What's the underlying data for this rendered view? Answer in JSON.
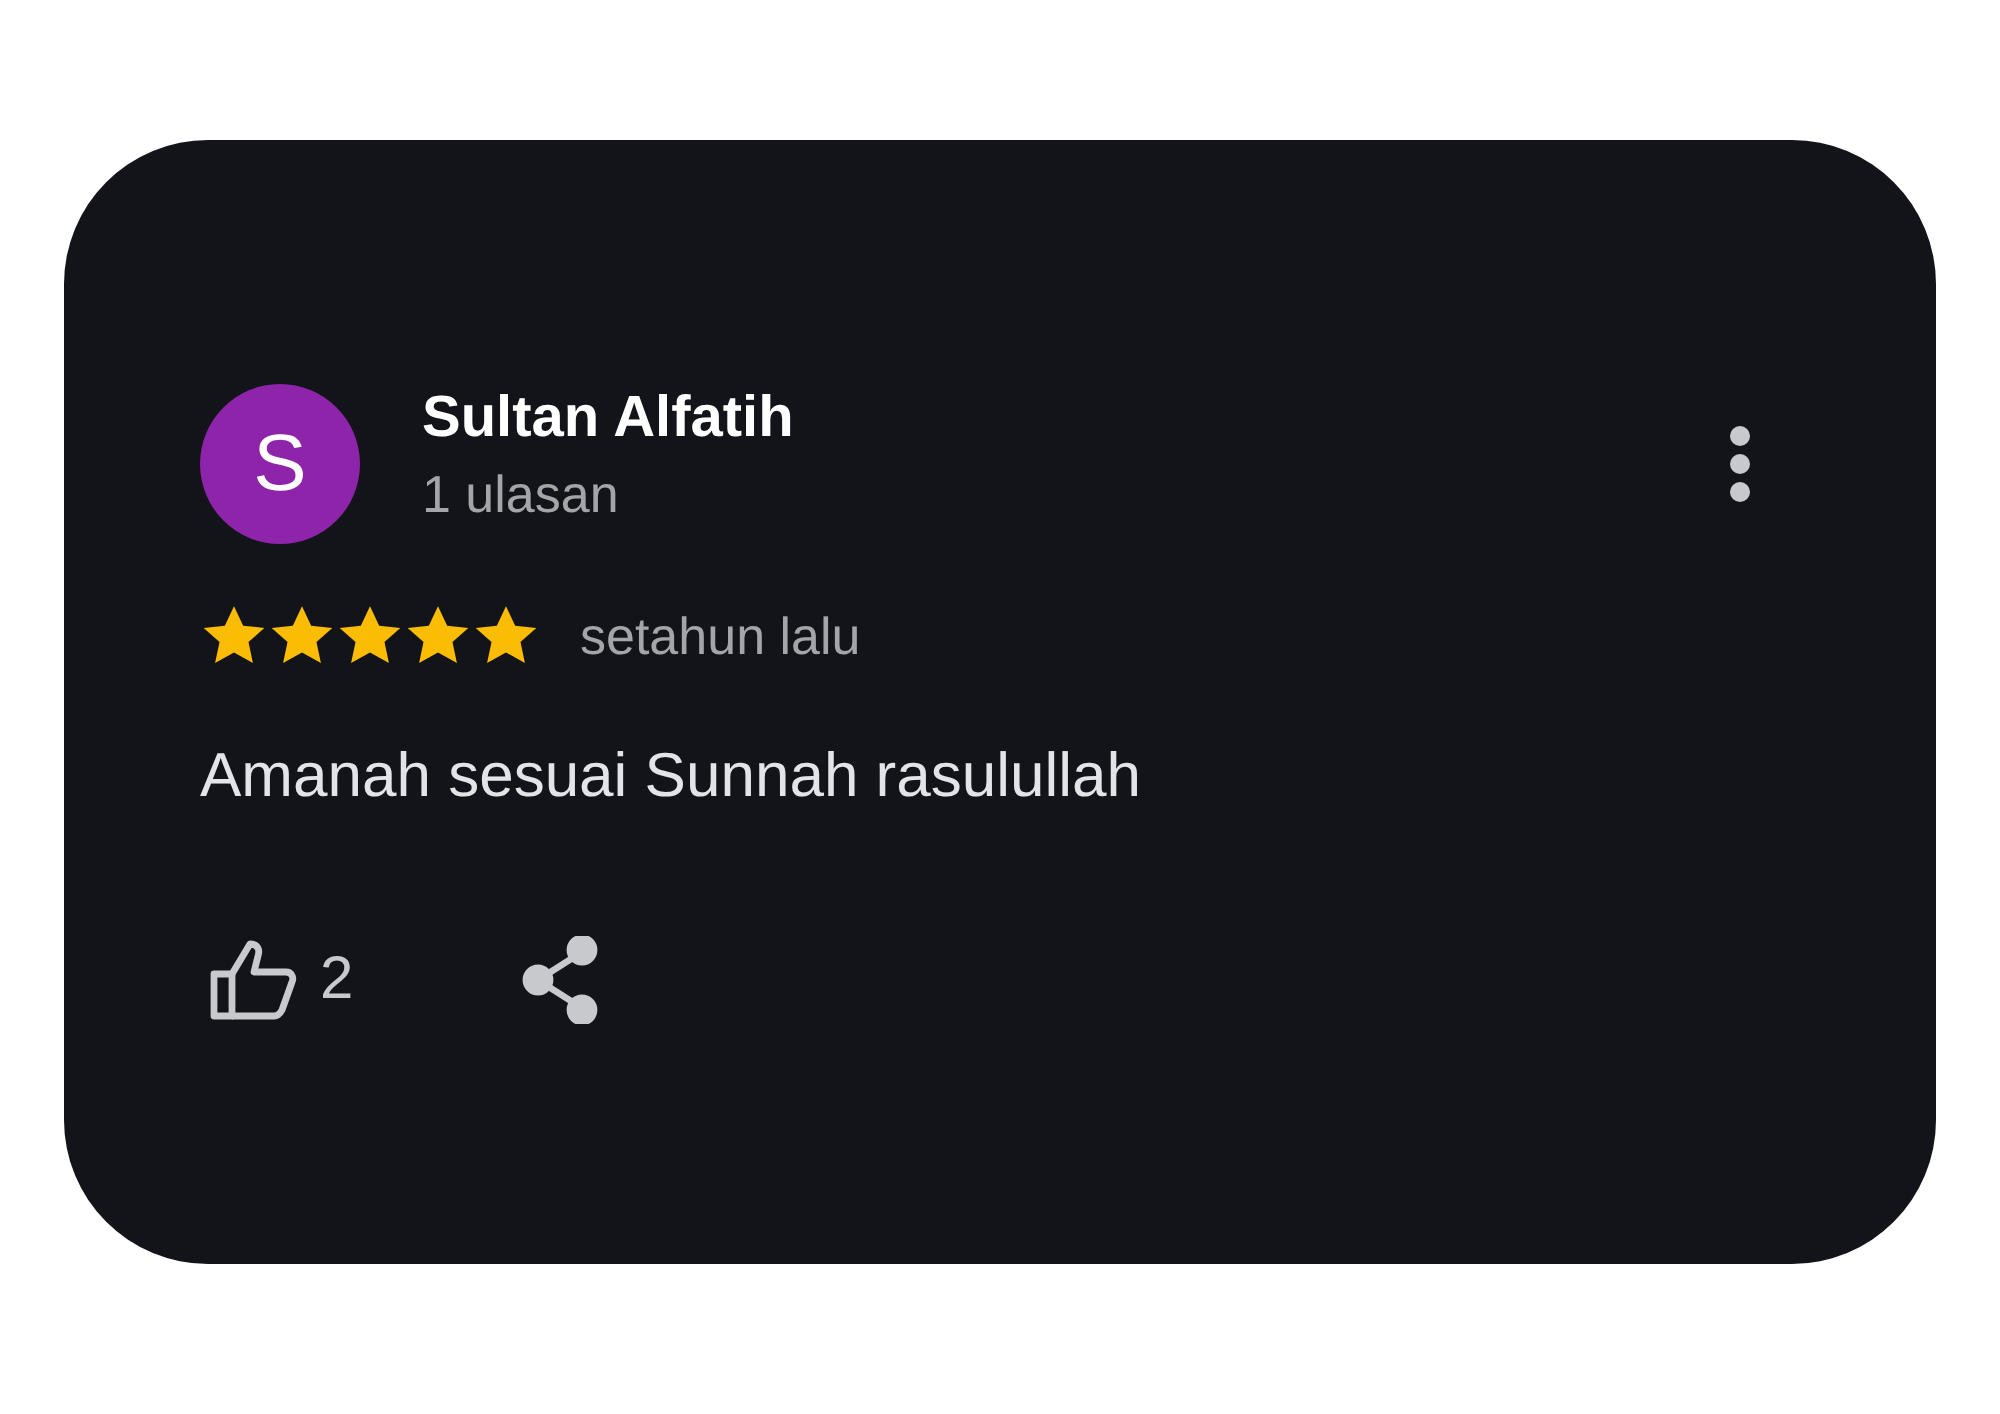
{
  "review": {
    "avatar_initial": "S",
    "name": "Sultan Alfatih",
    "review_count": "1 ulasan",
    "stars": 5,
    "time": "setahun lalu",
    "text": "Amanah sesuai Sunnah rasulullah",
    "likes": "2"
  }
}
